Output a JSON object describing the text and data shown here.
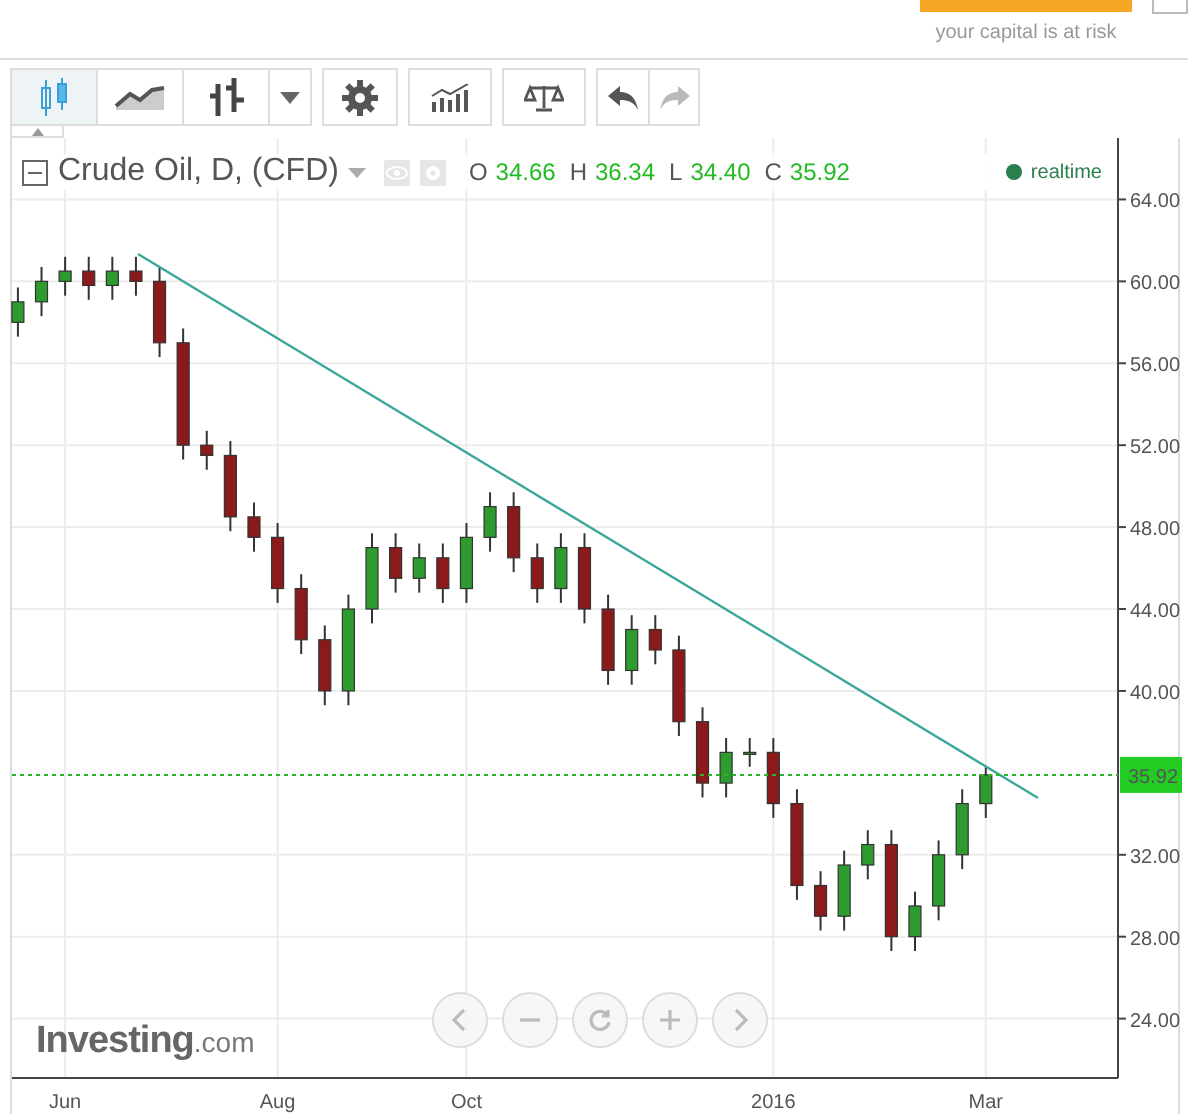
{
  "header": {
    "risk_note": "your capital is at risk"
  },
  "toolbar": [
    {
      "kind": "candles",
      "selected": true,
      "disabled": false
    },
    {
      "kind": "line",
      "selected": false,
      "disabled": false
    },
    {
      "kind": "bars",
      "selected": false,
      "disabled": false
    },
    {
      "kind": "dropdown",
      "selected": false,
      "disabled": false
    },
    {
      "kind": "settings",
      "selected": false,
      "disabled": false
    },
    {
      "kind": "indicators",
      "selected": false,
      "disabled": false
    },
    {
      "kind": "compare",
      "selected": false,
      "disabled": false
    },
    {
      "kind": "undo",
      "selected": false,
      "disabled": false
    },
    {
      "kind": "redo",
      "selected": false,
      "disabled": true
    }
  ],
  "legend": {
    "title": "Crude Oil, D, (CFD)",
    "ohlc": [
      {
        "label": "O",
        "value": "34.66"
      },
      {
        "label": "H",
        "value": "36.34"
      },
      {
        "label": "L",
        "value": "34.40"
      },
      {
        "label": "C",
        "value": "35.92"
      }
    ],
    "status": "realtime"
  },
  "chart": {
    "logo": {
      "name": "Investing",
      "suffix": ".com"
    },
    "chart_data": {
      "type": "candlestick",
      "grid": true,
      "ylim": [
        21.1,
        67.0
      ],
      "categories": [
        null,
        null,
        "Jun",
        null,
        null,
        null,
        null,
        null,
        null,
        null,
        null,
        "Aug",
        null,
        null,
        null,
        null,
        null,
        null,
        null,
        "Oct",
        null,
        null,
        null,
        null,
        null,
        null,
        null,
        null,
        null,
        null,
        null,
        null,
        "2016",
        null,
        null,
        null,
        null,
        null,
        null,
        null,
        null,
        "Mar",
        null,
        null
      ],
      "yticks": [
        {
          "value": 24,
          "label": "24.00"
        },
        {
          "value": 28,
          "label": "28.00"
        },
        {
          "value": 32,
          "label": "32.00"
        },
        {
          "value": 40,
          "label": "40.00"
        },
        {
          "value": 44,
          "label": "44.00"
        },
        {
          "value": 48,
          "label": "48.00"
        },
        {
          "value": 52,
          "label": "52.00"
        },
        {
          "value": 56,
          "label": "56.00"
        },
        {
          "value": 60,
          "label": "60.00"
        },
        {
          "value": 64,
          "label": "64.00"
        }
      ],
      "ohlc": [
        [
          58.0,
          59.7,
          57.3,
          59.0
        ],
        [
          59.0,
          60.7,
          58.3,
          60.0
        ],
        [
          60.0,
          61.2,
          59.3,
          60.5
        ],
        [
          60.5,
          61.2,
          59.1,
          59.8
        ],
        [
          59.8,
          61.2,
          59.1,
          60.5
        ],
        [
          60.5,
          61.2,
          59.3,
          60.0
        ],
        [
          60.0,
          60.7,
          56.3,
          57.0
        ],
        [
          57.0,
          57.7,
          51.3,
          52.0
        ],
        [
          52.0,
          52.7,
          50.8,
          51.5
        ],
        [
          51.5,
          52.2,
          47.8,
          48.5
        ],
        [
          48.5,
          49.2,
          46.8,
          47.5
        ],
        [
          47.5,
          48.2,
          44.3,
          45.0
        ],
        [
          45.0,
          45.7,
          41.8,
          42.5
        ],
        [
          42.5,
          43.2,
          39.3,
          40.0
        ],
        [
          40.0,
          44.7,
          39.3,
          44.0
        ],
        [
          44.0,
          47.7,
          43.3,
          47.0
        ],
        [
          47.0,
          47.7,
          44.8,
          45.5
        ],
        [
          45.5,
          47.2,
          44.8,
          46.5
        ],
        [
          46.5,
          47.2,
          44.3,
          45.0
        ],
        [
          45.0,
          48.2,
          44.3,
          47.5
        ],
        [
          47.5,
          49.7,
          46.8,
          49.0
        ],
        [
          49.0,
          49.7,
          45.8,
          46.5
        ],
        [
          46.5,
          47.2,
          44.3,
          45.0
        ],
        [
          45.0,
          47.7,
          44.3,
          47.0
        ],
        [
          47.0,
          47.7,
          43.3,
          44.0
        ],
        [
          44.0,
          44.7,
          40.3,
          41.0
        ],
        [
          41.0,
          43.7,
          40.3,
          43.0
        ],
        [
          43.0,
          43.7,
          41.3,
          42.0
        ],
        [
          42.0,
          42.7,
          37.8,
          38.5
        ],
        [
          38.5,
          39.2,
          34.8,
          35.5
        ],
        [
          35.5,
          37.7,
          34.8,
          37.0
        ],
        [
          37.0,
          37.7,
          36.3,
          37.0
        ],
        [
          37.0,
          37.7,
          33.8,
          34.5
        ],
        [
          34.5,
          35.2,
          29.8,
          30.5
        ],
        [
          30.5,
          31.2,
          28.3,
          29.0
        ],
        [
          29.0,
          32.2,
          28.3,
          31.5
        ],
        [
          31.5,
          33.2,
          30.8,
          32.5
        ],
        [
          32.5,
          33.2,
          27.3,
          28.0
        ],
        [
          28.0,
          30.2,
          27.3,
          29.5
        ],
        [
          29.5,
          32.7,
          28.8,
          32.0
        ],
        [
          32.0,
          35.2,
          31.3,
          34.5
        ],
        [
          34.5,
          36.3,
          33.8,
          35.9
        ],
        null,
        null
      ]
    },
    "last_price": "35.92",
    "navigation": [
      {
        "kind": "left"
      },
      {
        "kind": "zoom_out"
      },
      {
        "kind": "reset"
      },
      {
        "kind": "zoom_in"
      },
      {
        "kind": "right"
      }
    ]
  }
}
